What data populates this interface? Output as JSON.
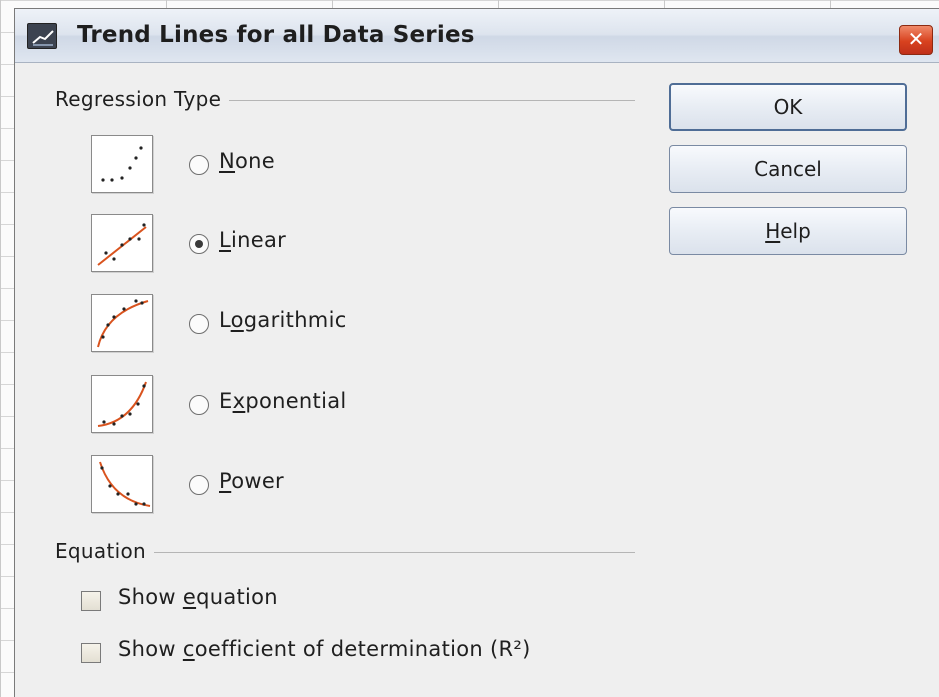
{
  "dialog": {
    "title": "Trend Lines for all Data Series",
    "close_glyph": "✕"
  },
  "regression": {
    "section_label": "Regression Type",
    "selected": "linear",
    "options": [
      {
        "id": "none",
        "label_pre": "",
        "mnemonic": "N",
        "label_post": "one",
        "checked": false,
        "icon": "scatter-none-icon"
      },
      {
        "id": "linear",
        "label_pre": "",
        "mnemonic": "L",
        "label_post": "inear",
        "checked": true,
        "icon": "linear-trend-icon"
      },
      {
        "id": "logarithmic",
        "label_pre": "L",
        "mnemonic": "o",
        "label_post": "garithmic",
        "checked": false,
        "icon": "logarithmic-trend-icon"
      },
      {
        "id": "exponential",
        "label_pre": "E",
        "mnemonic": "x",
        "label_post": "ponential",
        "checked": false,
        "icon": "exponential-trend-icon"
      },
      {
        "id": "power",
        "label_pre": "",
        "mnemonic": "P",
        "label_post": "ower",
        "checked": false,
        "icon": "power-trend-icon"
      }
    ]
  },
  "equation": {
    "section_label": "Equation",
    "show_equation": {
      "label_pre": "Show ",
      "mnemonic": "e",
      "label_post": "quation",
      "checked": false
    },
    "show_r2": {
      "label_pre": "Show ",
      "mnemonic": "c",
      "label_post": "oefficient of determination (R²)",
      "checked": false
    }
  },
  "buttons": {
    "ok": {
      "label_pre": "OK",
      "mnemonic": "",
      "label_post": ""
    },
    "cancel": {
      "label_pre": "Cancel",
      "mnemonic": "",
      "label_post": ""
    },
    "help": {
      "label_pre": "",
      "mnemonic": "H",
      "label_post": "elp"
    }
  },
  "colors": {
    "trend_line": "#d9531e",
    "points": "#222222"
  }
}
